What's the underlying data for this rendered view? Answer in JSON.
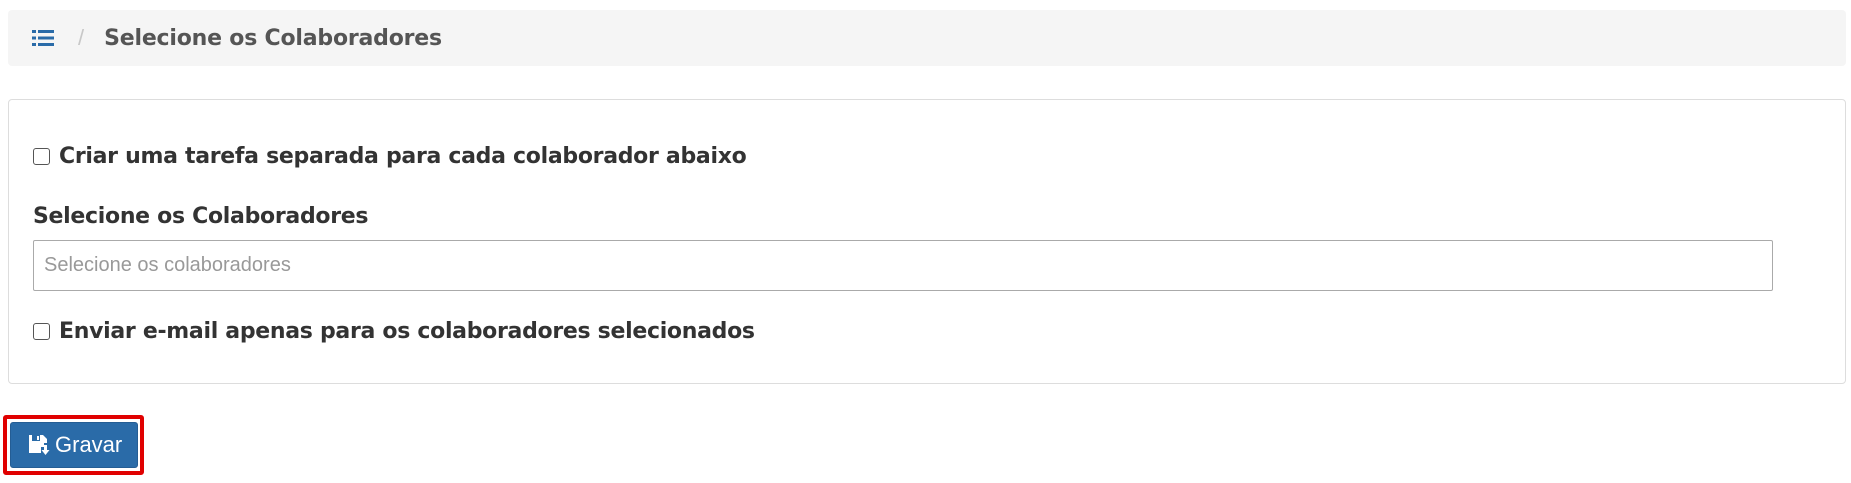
{
  "breadcrumb": {
    "icon": "list-icon",
    "separator": "/",
    "title": "Selecione os Colaboradores"
  },
  "form": {
    "separate_task_label": "Criar uma tarefa separada para cada colaborador abaixo",
    "separate_task_checked": false,
    "collaborators_label": "Selecione os Colaboradores",
    "collaborators_placeholder": "Selecione os colaboradores",
    "email_only_label": "Enviar e-mail apenas para os colaboradores selecionados",
    "email_only_checked": false
  },
  "actions": {
    "save_label": "Gravar",
    "save_icon": "save-icon"
  },
  "colors": {
    "primary": "#2a6ba8",
    "highlight": "#e00000",
    "breadcrumb_bg": "#f5f5f5",
    "icon_blue": "#2a6ba8"
  }
}
